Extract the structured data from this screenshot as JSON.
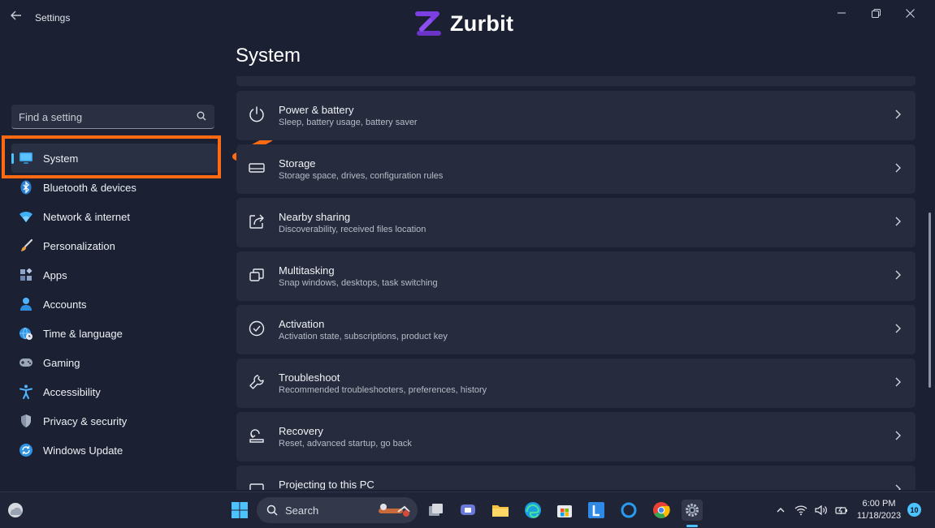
{
  "window": {
    "title": "Settings",
    "back_icon": "back-arrow-icon",
    "controls": [
      "minimize-icon",
      "restore-icon",
      "close-icon"
    ]
  },
  "watermark": {
    "text": "Zurbit",
    "accent": "#7b3fe4"
  },
  "sidebar": {
    "search_placeholder": "Find a setting",
    "items": [
      {
        "label": "System",
        "icon": "monitor-icon",
        "selected": true
      },
      {
        "label": "Bluetooth & devices",
        "icon": "bluetooth-icon"
      },
      {
        "label": "Network & internet",
        "icon": "wifi-icon"
      },
      {
        "label": "Personalization",
        "icon": "brush-icon"
      },
      {
        "label": "Apps",
        "icon": "apps-icon"
      },
      {
        "label": "Accounts",
        "icon": "person-icon"
      },
      {
        "label": "Time & language",
        "icon": "globe-clock-icon"
      },
      {
        "label": "Gaming",
        "icon": "gamepad-icon"
      },
      {
        "label": "Accessibility",
        "icon": "accessibility-icon"
      },
      {
        "label": "Privacy & security",
        "icon": "shield-icon"
      },
      {
        "label": "Windows Update",
        "icon": "update-icon"
      }
    ]
  },
  "main": {
    "title": "System",
    "cards": [
      {
        "title": "Power & battery",
        "subtitle": "Sleep, battery usage, battery saver",
        "icon": "power-icon"
      },
      {
        "title": "Storage",
        "subtitle": "Storage space, drives, configuration rules",
        "icon": "storage-icon"
      },
      {
        "title": "Nearby sharing",
        "subtitle": "Discoverability, received files location",
        "icon": "share-icon"
      },
      {
        "title": "Multitasking",
        "subtitle": "Snap windows, desktops, task switching",
        "icon": "multitasking-icon"
      },
      {
        "title": "Activation",
        "subtitle": "Activation state, subscriptions, product key",
        "icon": "activation-check-icon"
      },
      {
        "title": "Troubleshoot",
        "subtitle": "Recommended troubleshooters, preferences, history",
        "icon": "wrench-icon"
      },
      {
        "title": "Recovery",
        "subtitle": "Reset, advanced startup, go back",
        "icon": "recovery-icon"
      },
      {
        "title": "Projecting to this PC",
        "subtitle": "",
        "icon": "projecting-icon"
      }
    ]
  },
  "annotation": {
    "color": "#ff6a13"
  },
  "taskbar": {
    "search_label": "Search",
    "apps": [
      "task-view-icon",
      "chat-icon",
      "file-explorer-icon",
      "edge-icon",
      "store-icon",
      "l-app-icon",
      "cortana-icon",
      "chrome-icon",
      "settings-gear-icon"
    ],
    "tray": [
      "chevron-up-icon",
      "wifi-icon",
      "volume-icon",
      "battery-icon"
    ],
    "time": "6:00 PM",
    "date": "11/18/2023",
    "notification_count": "10"
  },
  "colors": {
    "accent": "#4cc2ff",
    "background": "#1b2133",
    "card": "#262c3d"
  }
}
